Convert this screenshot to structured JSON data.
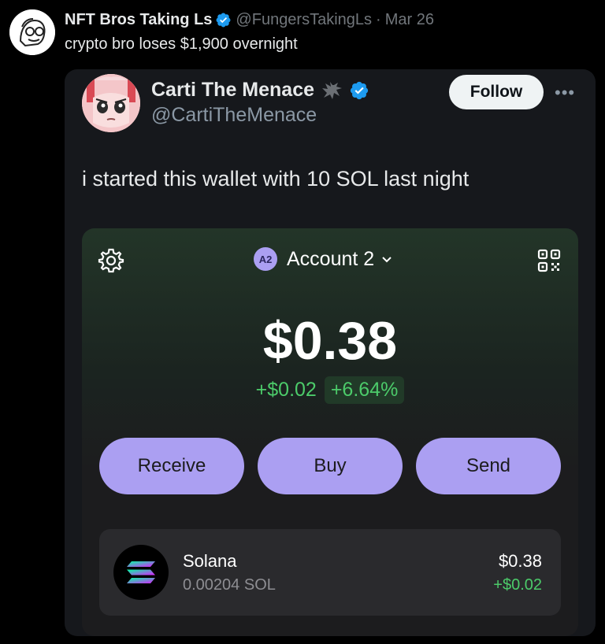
{
  "outer_tweet": {
    "name": "NFT Bros Taking Ls",
    "handle": "@FungersTakingLs",
    "separator": "·",
    "date": "Mar 26",
    "text": "crypto bro loses $1,900 overnight"
  },
  "quoted_tweet": {
    "name": "Carti The Menace",
    "handle": "@CartiTheMenace",
    "follow_label": "Follow",
    "more_label": "•••",
    "text": "i started this wallet with 10 SOL last night"
  },
  "wallet": {
    "account_badge": "A2",
    "account_label": "Account 2",
    "balance": "$0.38",
    "change_abs": "+$0.02",
    "change_pct": "+6.64%",
    "buttons": {
      "receive": "Receive",
      "buy": "Buy",
      "send": "Send"
    },
    "token": {
      "name": "Solana",
      "amount": "0.00204 SOL",
      "value": "$0.38",
      "change": "+$0.02"
    }
  },
  "colors": {
    "accent_purple": "#ab9ff2",
    "positive_green": "#4ccb6a",
    "verified_blue": "#1d9bf0"
  },
  "icons": [
    "verified-badge-icon",
    "bat-icon",
    "gear-icon",
    "qr-code-icon",
    "chevron-down-icon",
    "solana-logo-icon",
    "more-icon"
  ]
}
